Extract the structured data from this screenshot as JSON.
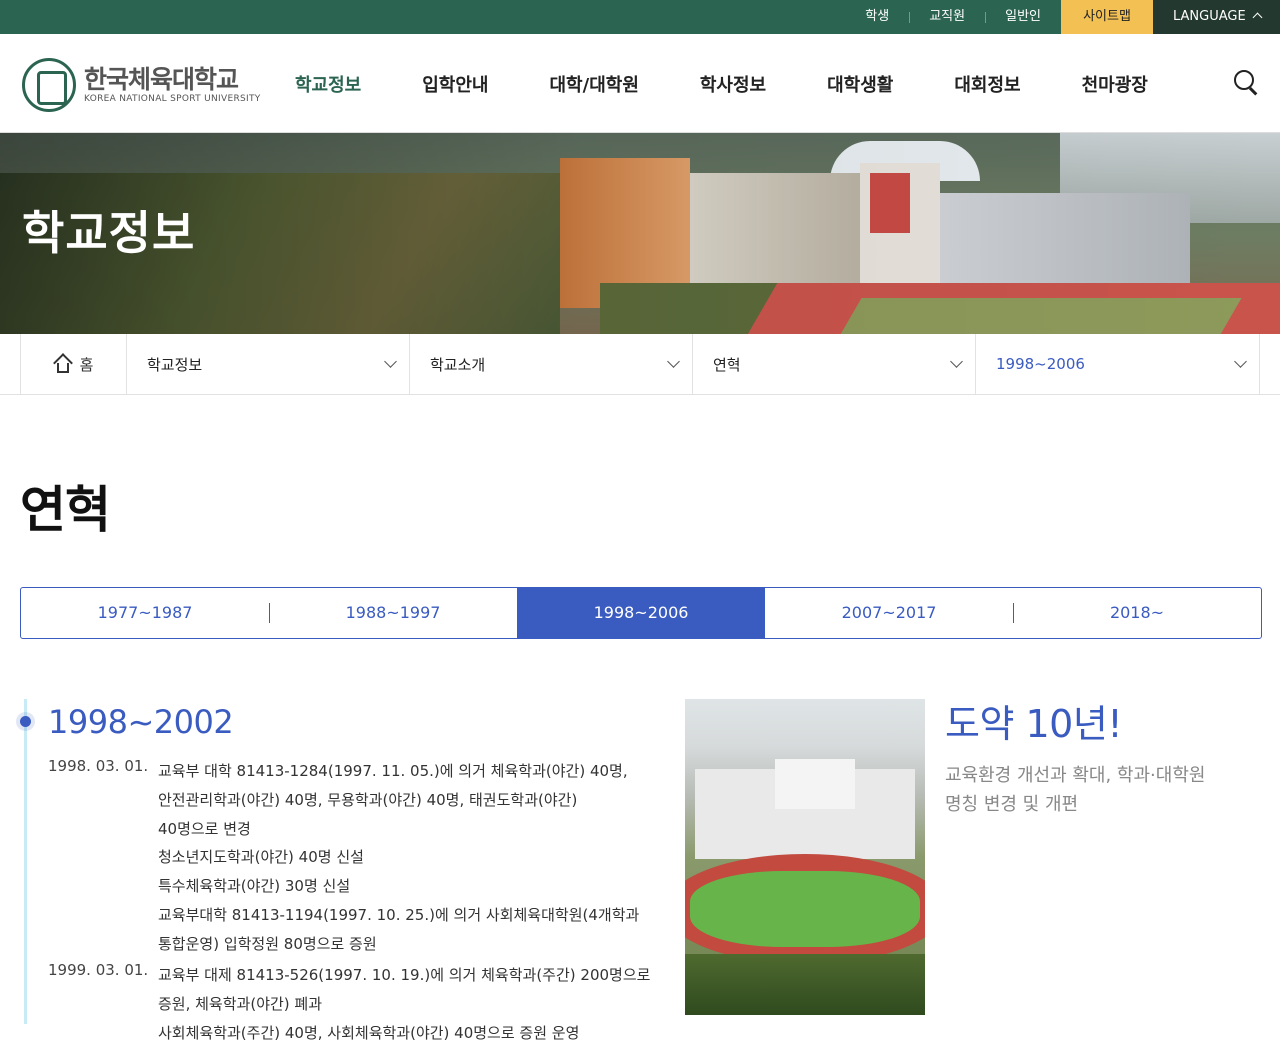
{
  "topbar": {
    "links": [
      "학생",
      "교직원",
      "일반인"
    ],
    "sitemap": "사이트맵",
    "language": "LANGUAGE"
  },
  "logo": {
    "korean": "한국체육대학교",
    "english": "KOREA NATIONAL SPORT UNIVERSITY"
  },
  "nav": {
    "items": [
      "학교정보",
      "입학안내",
      "대학/대학원",
      "학사정보",
      "대학생활",
      "대회정보",
      "천마광장"
    ],
    "active_index": 0
  },
  "hero": {
    "title": "학교정보"
  },
  "breadcrumb": {
    "home": "홈",
    "levels": [
      "학교정보",
      "학교소개",
      "연혁",
      "1998~2006"
    ]
  },
  "page": {
    "title": "연혁"
  },
  "period_tabs": {
    "items": [
      "1977~1987",
      "1988~1997",
      "1998~2006",
      "2007~2017",
      "2018~"
    ],
    "active_index": 2
  },
  "timeline": {
    "range": "1998~2002",
    "entries": [
      {
        "date": "1998. 03. 01.",
        "lines": [
          "교육부 대학 81413-1284(1997. 11. 05.)에 의거 체육학과(야간) 40명,",
          "안전관리학과(야간) 40명, 무용학과(야간) 40명, 태권도학과(야간)",
          "40명으로 변경",
          "청소년지도학과(야간) 40명 신설",
          "특수체육학과(야간) 30명 신설",
          "교육부대학 81413-1194(1997. 10. 25.)에 의거 사회체육대학원(4개학과",
          "통합운영) 입학정원 80명으로 증원"
        ]
      },
      {
        "date": "1999. 03. 01.",
        "lines": [
          "교육부 대제 81413-526(1997. 10. 19.)에 의거 체육학과(주간) 200명으로",
          "증원, 체육학과(야간) 폐과",
          "사회체육학과(주간) 40명, 사회체육학과(야간) 40명으로 증원 운영"
        ]
      }
    ]
  },
  "feature": {
    "headline": "도약 10년!",
    "description": [
      "교육환경 개선과 확대, 학과·대학원",
      "명칭 변경 및 개편"
    ]
  },
  "colors": {
    "brand_green": "#2b6450",
    "sitemap_yellow": "#f3c054",
    "language_dark": "#23382f",
    "accent_blue": "#3a5bc0"
  }
}
